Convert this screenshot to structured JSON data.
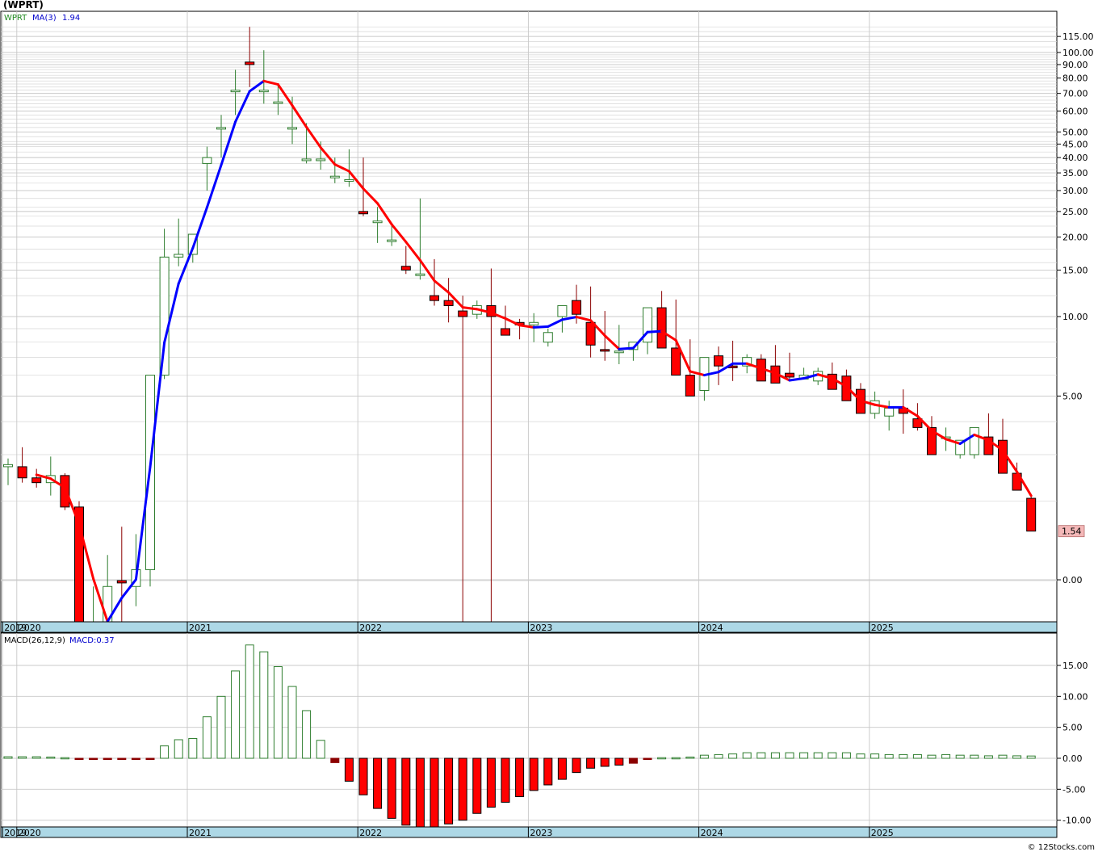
{
  "header": {
    "symbol_label": "(WPRT)"
  },
  "price_panel": {
    "legend": {
      "symbol": "WPRT",
      "ma_label": "MA(3)",
      "ma_value": "1.94"
    },
    "last_price_badge": "1.54",
    "y_ticks": [
      {
        "label": "115.00",
        "value": 115
      },
      {
        "label": "100.00",
        "value": 100
      },
      {
        "label": "90.00",
        "value": 90
      },
      {
        "label": "80.00",
        "value": 80
      },
      {
        "label": "70.00",
        "value": 70
      },
      {
        "label": "60.00",
        "value": 60
      },
      {
        "label": "50.00",
        "value": 50
      },
      {
        "label": "45.00",
        "value": 45
      },
      {
        "label": "40.00",
        "value": 40
      },
      {
        "label": "35.00",
        "value": 35
      },
      {
        "label": "30.00",
        "value": 30
      },
      {
        "label": "25.00",
        "value": 25
      },
      {
        "label": "20.00",
        "value": 20
      },
      {
        "label": "15.00",
        "value": 15
      },
      {
        "label": "10.00",
        "value": 10
      },
      {
        "label": "5.00",
        "value": 5
      },
      {
        "label": "0.00",
        "value": 0
      }
    ]
  },
  "macd_panel": {
    "legend": {
      "label": "MACD(26,12,9)",
      "value_label": "MACD:0.37"
    },
    "y_ticks": [
      {
        "label": "15.00",
        "value": 15
      },
      {
        "label": "10.00",
        "value": 10
      },
      {
        "label": "5.00",
        "value": 5
      },
      {
        "label": "0.00",
        "value": 0
      },
      {
        "label": "-5.00",
        "value": -5
      },
      {
        "label": "-10.00",
        "value": -10
      }
    ]
  },
  "x_axis": {
    "labels": [
      "2019",
      "2020",
      "2021",
      "2022",
      "2023",
      "2024",
      "2025"
    ],
    "label_month_index": [
      0,
      1,
      13,
      25,
      37,
      49,
      61
    ]
  },
  "footer": {
    "copyright": "© 12Stocks.com"
  },
  "colors": {
    "up_candle_border": "#2e7d2e",
    "down_candle_fill": "#ff0000",
    "ma_up": "#0000ff",
    "ma_down": "#ff0000",
    "axis_band": "#add8e6",
    "grid": "#c8c8c8",
    "badge_bg": "#f4b8b8",
    "legend_symbol": "#228b22",
    "legend_ma": "#0000cd"
  },
  "chart_data": [
    {
      "type": "candlestick",
      "title": "(WPRT)",
      "scale": "log",
      "grid": true,
      "ma_period": 3,
      "categories": [
        "2019-11",
        "2019-12",
        "2020-01",
        "2020-02",
        "2020-03",
        "2020-04",
        "2020-05",
        "2020-06",
        "2020-07",
        "2020-08",
        "2020-09",
        "2020-10",
        "2020-11",
        "2020-12",
        "2021-01",
        "2021-02",
        "2021-03",
        "2021-04",
        "2021-05",
        "2021-06",
        "2021-07",
        "2021-08",
        "2021-09",
        "2021-10",
        "2021-11",
        "2021-12",
        "2022-01",
        "2022-02",
        "2022-03",
        "2022-04",
        "2022-05",
        "2022-06",
        "2022-07",
        "2022-08",
        "2022-09",
        "2022-10",
        "2022-11",
        "2022-12",
        "2023-01",
        "2023-02",
        "2023-03",
        "2023-04",
        "2023-05",
        "2023-06",
        "2023-07",
        "2023-08",
        "2023-09",
        "2023-10",
        "2023-11",
        "2023-12",
        "2024-01",
        "2024-02",
        "2024-03",
        "2024-04",
        "2024-05",
        "2024-06",
        "2024-07",
        "2024-08",
        "2024-09",
        "2024-10",
        "2024-11",
        "2024-12",
        "2025-01",
        "2025-02",
        "2025-03",
        "2025-04",
        "2025-05",
        "2025-06",
        "2025-07",
        "2025-08",
        "2025-09",
        "2025-10",
        "2025-11"
      ],
      "open": [
        2.7,
        2.7,
        2.45,
        2.35,
        2.5,
        1.9,
        0.5,
        0.65,
        1.0,
        0.95,
        1.1,
        6.0,
        16.8,
        17.2,
        38.0,
        52.0,
        72.0,
        92.0,
        72.0,
        65.0,
        52.0,
        39.5,
        39.5,
        34.0,
        33.0,
        25.0,
        23.0,
        19.5,
        15.5,
        14.5,
        12.0,
        11.5,
        10.5,
        10.2,
        11.0,
        9.0,
        9.5,
        9.3,
        8.0,
        10.0,
        11.5,
        9.5,
        7.5,
        7.3,
        7.5,
        8.0,
        10.8,
        7.6,
        6.0,
        5.25,
        7.1,
        6.5,
        6.5,
        6.9,
        6.5,
        6.1,
        5.8,
        5.7,
        6.05,
        5.95,
        5.3,
        4.3,
        4.2,
        4.5,
        4.1,
        3.8,
        3.5,
        3.0,
        3.0,
        3.5,
        3.4,
        2.55,
        2.05
      ],
      "high": [
        2.9,
        3.2,
        2.65,
        2.95,
        2.55,
        2.0,
        0.95,
        1.25,
        1.6,
        1.5,
        2.1,
        21.5,
        23.5,
        20.5,
        44.0,
        58.0,
        86.0,
        125.0,
        102.0,
        75.0,
        68.0,
        54.0,
        46.0,
        40.0,
        43.0,
        40.0,
        26.0,
        22.0,
        18.5,
        28.0,
        16.5,
        14.0,
        12.0,
        11.5,
        15.2,
        11.0,
        9.8,
        10.3,
        9.0,
        11.0,
        13.2,
        13.0,
        10.5,
        9.3,
        8.0,
        10.3,
        12.5,
        11.6,
        8.2,
        6.3,
        7.7,
        8.1,
        7.2,
        7.2,
        7.8,
        7.3,
        6.4,
        6.4,
        6.7,
        6.3,
        5.6,
        5.2,
        4.8,
        5.3,
        4.7,
        4.2,
        3.8,
        3.3,
        3.8,
        4.3,
        4.1,
        2.8,
        2.1
      ],
      "low": [
        2.3,
        2.35,
        2.25,
        2.1,
        1.85,
        0.35,
        0.32,
        0.42,
        0.6,
        0.8,
        0.95,
        5.8,
        15.5,
        16.0,
        30.0,
        40.0,
        58.0,
        74.0,
        64.0,
        58.0,
        45.0,
        38.0,
        36.0,
        32.0,
        31.0,
        24.0,
        19.0,
        18.5,
        14.5,
        13.8,
        11.0,
        9.5,
        0.45,
        9.8,
        0.3,
        8.8,
        8.2,
        8.0,
        7.7,
        8.7,
        9.4,
        7.0,
        6.8,
        6.6,
        6.8,
        7.2,
        7.6,
        6.5,
        5.1,
        4.8,
        5.5,
        5.7,
        6.1,
        5.7,
        5.8,
        5.8,
        5.8,
        5.5,
        5.4,
        4.9,
        4.4,
        4.1,
        3.7,
        3.6,
        3.7,
        3.0,
        3.1,
        2.9,
        2.9,
        3.1,
        2.85,
        2.35,
        1.54
      ],
      "close": [
        2.75,
        2.45,
        2.35,
        2.5,
        1.9,
        0.5,
        0.65,
        0.95,
        0.98,
        1.1,
        6.0,
        16.8,
        17.2,
        20.5,
        40.0,
        52.0,
        72.0,
        90.0,
        72.0,
        65.0,
        52.0,
        39.5,
        39.5,
        34.0,
        33.0,
        24.5,
        23.0,
        19.5,
        15.0,
        14.5,
        11.5,
        11.0,
        10.0,
        11.0,
        10.0,
        8.5,
        9.3,
        9.5,
        8.7,
        11.0,
        10.2,
        7.8,
        7.4,
        7.4,
        8.0,
        10.8,
        7.6,
        6.0,
        5.0,
        7.0,
        6.5,
        6.4,
        7.0,
        5.7,
        5.6,
        5.9,
        6.0,
        6.2,
        5.3,
        4.8,
        4.3,
        4.8,
        4.5,
        4.3,
        3.8,
        3.0,
        3.5,
        3.4,
        3.8,
        3.0,
        2.55,
        2.2,
        1.54
      ]
    },
    {
      "type": "bar",
      "title": "MACD(26,12,9)",
      "categories": [
        "2019-11",
        "2019-12",
        "2020-01",
        "2020-02",
        "2020-03",
        "2020-04",
        "2020-05",
        "2020-06",
        "2020-07",
        "2020-08",
        "2020-09",
        "2020-10",
        "2020-11",
        "2020-12",
        "2021-01",
        "2021-02",
        "2021-03",
        "2021-04",
        "2021-05",
        "2021-06",
        "2021-07",
        "2021-08",
        "2021-09",
        "2021-10",
        "2021-11",
        "2021-12",
        "2022-01",
        "2022-02",
        "2022-03",
        "2022-04",
        "2022-05",
        "2022-06",
        "2022-07",
        "2022-08",
        "2022-09",
        "2022-10",
        "2022-11",
        "2022-12",
        "2023-01",
        "2023-02",
        "2023-03",
        "2023-04",
        "2023-05",
        "2023-06",
        "2023-07",
        "2023-08",
        "2023-09",
        "2023-10",
        "2023-11",
        "2023-12",
        "2024-01",
        "2024-02",
        "2024-03",
        "2024-04",
        "2024-05",
        "2024-06",
        "2024-07",
        "2024-08",
        "2024-09",
        "2024-10",
        "2024-11",
        "2024-12",
        "2025-01",
        "2025-02",
        "2025-03",
        "2025-04",
        "2025-05",
        "2025-06",
        "2025-07",
        "2025-08",
        "2025-09",
        "2025-10",
        "2025-11"
      ],
      "values": [
        0.25,
        0.25,
        0.25,
        0.2,
        0.1,
        -0.1,
        -0.15,
        -0.15,
        -0.15,
        -0.1,
        -0.1,
        2.0,
        3.0,
        3.2,
        6.7,
        10.0,
        14.1,
        18.3,
        17.2,
        14.8,
        11.6,
        7.7,
        2.9,
        -0.7,
        -3.7,
        -5.9,
        -8.1,
        -9.7,
        -10.8,
        -11.1,
        -11.1,
        -10.6,
        -10.0,
        -8.9,
        -7.9,
        -7.1,
        -6.2,
        -5.2,
        -4.3,
        -3.4,
        -2.3,
        -1.6,
        -1.3,
        -1.1,
        -0.8,
        -0.1,
        0.1,
        0.1,
        0.2,
        0.5,
        0.6,
        0.7,
        0.9,
        0.9,
        0.9,
        0.9,
        0.9,
        0.9,
        0.9,
        0.9,
        0.7,
        0.7,
        0.6,
        0.6,
        0.6,
        0.5,
        0.6,
        0.5,
        0.5,
        0.4,
        0.5,
        0.4,
        0.37
      ],
      "ylim": [
        -11.5,
        19
      ]
    }
  ]
}
